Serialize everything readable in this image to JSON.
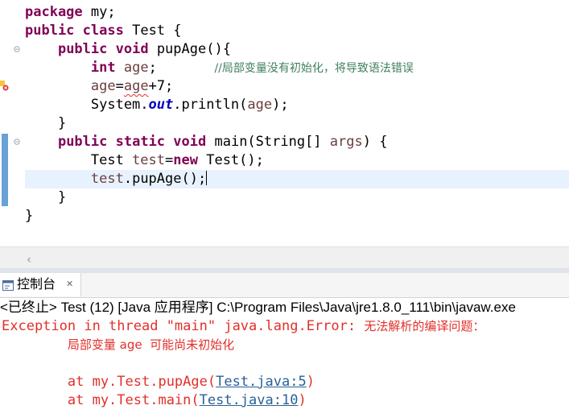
{
  "editor": {
    "code_lines": [
      [
        {
          "t": "package",
          "c": "kw"
        },
        {
          "t": " my;"
        }
      ],
      [
        {
          "t": "public",
          "c": "kw"
        },
        {
          "t": " "
        },
        {
          "t": "class",
          "c": "kw"
        },
        {
          "t": " Test {"
        }
      ],
      [
        {
          "t": "    "
        },
        {
          "t": "public",
          "c": "kw"
        },
        {
          "t": " "
        },
        {
          "t": "void",
          "c": "kw"
        },
        {
          "t": " pupAge(){"
        }
      ],
      [
        {
          "t": "        "
        },
        {
          "t": "int",
          "c": "kw"
        },
        {
          "t": " "
        },
        {
          "t": "age",
          "c": "var"
        },
        {
          "t": ";       "
        },
        {
          "t": "//局部变量没有初始化，将导致语法错误",
          "c": "comment"
        }
      ],
      [
        {
          "t": "        "
        },
        {
          "t": "age",
          "c": "var"
        },
        {
          "t": "="
        },
        {
          "t": "age",
          "c": "var squiggle"
        },
        {
          "t": "+7;"
        }
      ],
      [
        {
          "t": "        System."
        },
        {
          "t": "out",
          "c": "field"
        },
        {
          "t": ".println("
        },
        {
          "t": "age",
          "c": "var"
        },
        {
          "t": ");"
        }
      ],
      [
        {
          "t": "    }"
        }
      ],
      [
        {
          "t": "    "
        },
        {
          "t": "public",
          "c": "kw"
        },
        {
          "t": " "
        },
        {
          "t": "static",
          "c": "kw"
        },
        {
          "t": " "
        },
        {
          "t": "void",
          "c": "kw"
        },
        {
          "t": " main(String[] "
        },
        {
          "t": "args",
          "c": "var"
        },
        {
          "t": ") {"
        }
      ],
      [
        {
          "t": "        Test "
        },
        {
          "t": "test",
          "c": "var"
        },
        {
          "t": "="
        },
        {
          "t": "new",
          "c": "kw"
        },
        {
          "t": " Test();"
        }
      ],
      [
        {
          "t": "        "
        },
        {
          "t": "test",
          "c": "var"
        },
        {
          "t": ".pupAge();"
        }
      ],
      [
        {
          "t": "    }"
        }
      ],
      [
        {
          "t": "}"
        }
      ]
    ],
    "scroll_left_icon": "chevron-left-icon"
  },
  "console": {
    "tab_label": "控制台",
    "tab_icon": "console-icon",
    "close_icon": "close-icon",
    "status": "<已终止> Test (12) [Java 应用程序] C:\\Program Files\\Java\\jre1.8.0_111\\bin\\javaw.exe",
    "output_lines": [
      [
        {
          "t": "Exception in thread \"main\" java.lang.Error: "
        },
        {
          "t": "无法解析的编译问题：",
          "c": "cjk"
        }
      ],
      [
        {
          "t": "        "
        },
        {
          "t": "局部变量 age  可能尚未初始化",
          "c": "cjk"
        }
      ],
      [
        {
          "t": ""
        }
      ],
      [
        {
          "t": "        at my.Test.pupAge("
        },
        {
          "t": "Test.java:5",
          "c": "link"
        },
        {
          "t": ")"
        }
      ],
      [
        {
          "t": "        at my.Test.main("
        },
        {
          "t": "Test.java:10",
          "c": "link"
        },
        {
          "t": ")"
        }
      ]
    ]
  },
  "colors": {
    "keyword": "#7f0055",
    "variable": "#6a3e3e",
    "comment": "#3f7f5f",
    "static_field": "#0000c0",
    "error_text": "#e0302a",
    "link": "#2a6099",
    "current_line": "#e8f2fe"
  }
}
